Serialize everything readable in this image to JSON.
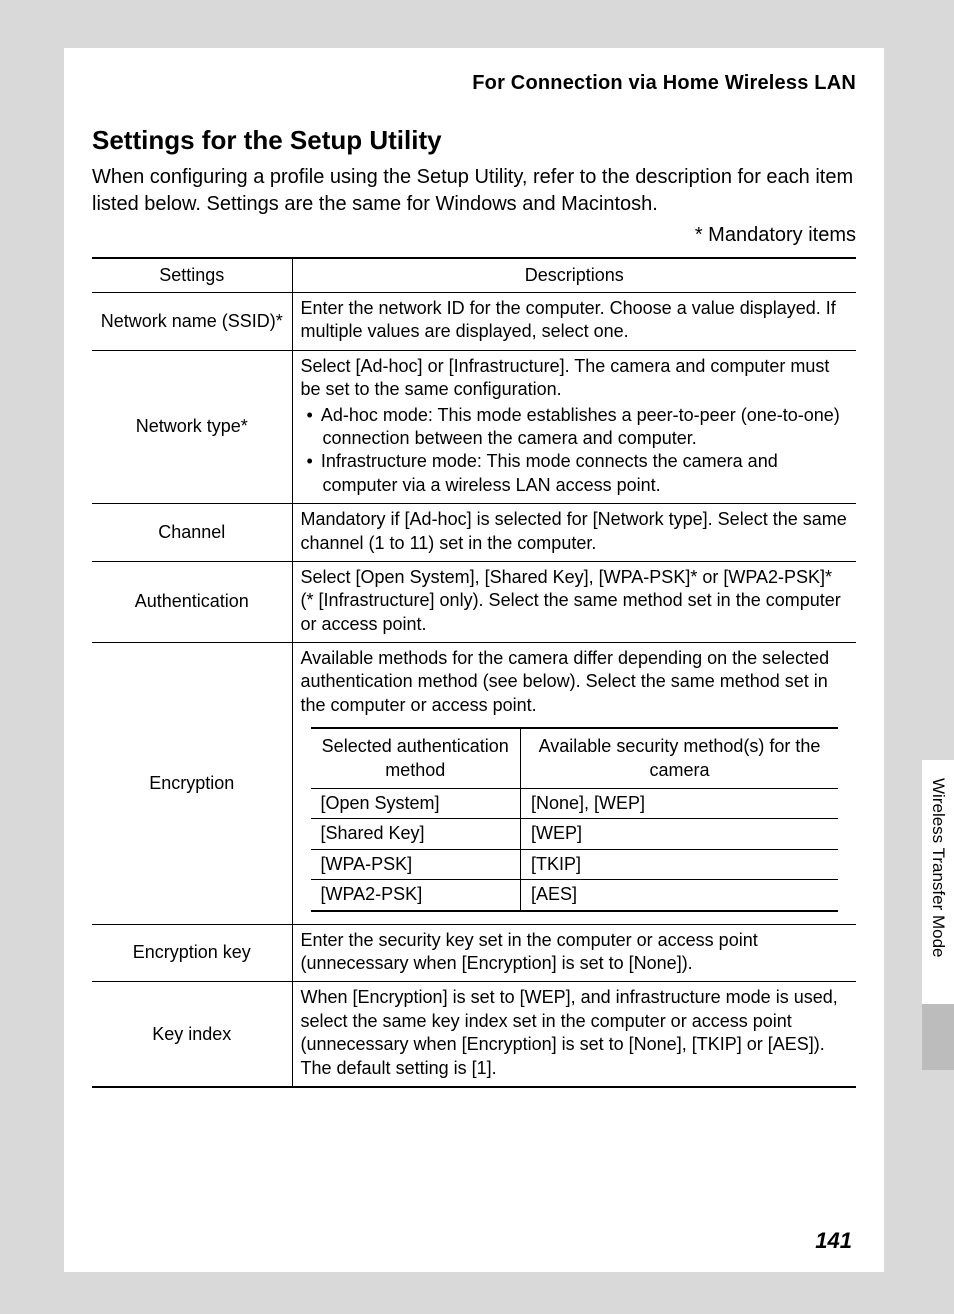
{
  "header": "For Connection via Home Wireless LAN",
  "section_title": "Settings for the Setup Utility",
  "intro": "When configuring a profile using the Setup Utility, refer to the description for each item listed below. Settings are the same for Windows and Macintosh.",
  "mandatory_note": "* Mandatory items",
  "table_headers": {
    "settings": "Settings",
    "descriptions": "Descriptions"
  },
  "rows": {
    "network_name": {
      "setting": "Network name (SSID)*",
      "desc": "Enter the network ID for the computer. Choose a value displayed. If multiple values are displayed, select one."
    },
    "network_type": {
      "setting": "Network type*",
      "desc_lead": "Select [Ad-hoc] or [Infrastructure]. The camera and computer must be set to the same configuration.",
      "bullets": [
        "Ad-hoc mode: This mode establishes a peer-to-peer (one-to-one) connection between the camera and computer.",
        "Infrastructure mode: This mode connects the camera and computer via a wireless LAN access point."
      ]
    },
    "channel": {
      "setting": "Channel",
      "desc": "Mandatory if [Ad-hoc] is selected for [Network type]. Select the same channel (1 to 11) set in the computer."
    },
    "authentication": {
      "setting": "Authentication",
      "desc": "Select [Open System], [Shared Key], [WPA-PSK]* or [WPA2-PSK]* (* [Infrastructure] only). Select the same method set in the computer or access point."
    },
    "encryption": {
      "setting": "Encryption",
      "desc_lead": "Available methods for the camera differ depending on the selected authentication method (see below). Select the same method set in the computer or access point.",
      "inner_headers": {
        "auth": "Selected authentication method",
        "avail": "Available security method(s) for the camera"
      },
      "inner_rows": [
        {
          "auth": "[Open System]",
          "avail": "[None], [WEP]"
        },
        {
          "auth": "[Shared Key]",
          "avail": "[WEP]"
        },
        {
          "auth": "[WPA-PSK]",
          "avail": "[TKIP]"
        },
        {
          "auth": "[WPA2-PSK]",
          "avail": "[AES]"
        }
      ]
    },
    "encryption_key": {
      "setting": "Encryption key",
      "desc": "Enter the security key set in the computer or access point (unnecessary when [Encryption] is set to [None])."
    },
    "key_index": {
      "setting": "Key index",
      "desc": "When [Encryption] is set to [WEP], and infrastructure mode is used, select the same key index set in the computer or access point (unnecessary when [Encryption] is set to [None], [TKIP] or [AES]). The default setting is [1]."
    }
  },
  "side_label": "Wireless Transfer Mode",
  "page_number": "141"
}
